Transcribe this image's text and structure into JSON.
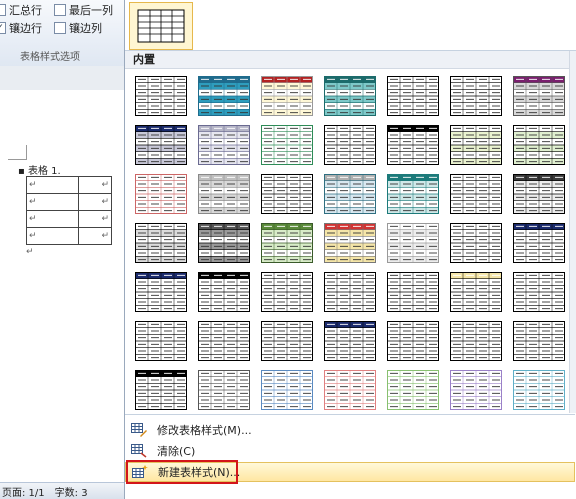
{
  "ribbon": {
    "options": [
      {
        "label": "汇总行",
        "checked": false
      },
      {
        "label": "最后一列",
        "checked": false
      },
      {
        "label": "镶边行",
        "checked": true
      },
      {
        "label": "镶边列",
        "checked": false
      }
    ],
    "group_label": "表格样式选项"
  },
  "document": {
    "table_label": "▪ 表格 1.",
    "cell_mark": "↵",
    "row_count": 4
  },
  "status": {
    "page": "页面: 1/1",
    "words": "字数: 3"
  },
  "gallery": {
    "section_title": "内置",
    "styles": [
      {
        "row": 0,
        "col": 0,
        "header": "#ffffff",
        "band": "#ffffff",
        "border": "#000000"
      },
      {
        "row": 0,
        "col": 1,
        "header": "#1f6b8c",
        "band": "#2e9dbd",
        "border": "#1f6b8c"
      },
      {
        "row": 0,
        "col": 2,
        "header": "#b22222",
        "band": "#fff8d6",
        "border": "#999999"
      },
      {
        "row": 0,
        "col": 3,
        "header": "#1c6b6b",
        "band": "#7ec9c9",
        "border": "#1c6b6b"
      },
      {
        "row": 0,
        "col": 4,
        "header": "#ffffff",
        "band": "#ffffff",
        "border": "#000000"
      },
      {
        "row": 0,
        "col": 5,
        "header": "#ffffff",
        "band": "#ffffff",
        "border": "#000000"
      },
      {
        "row": 0,
        "col": 6,
        "header": "#7a1f6e",
        "band": "#d9d9d9",
        "border": "#555555"
      },
      {
        "row": 1,
        "col": 0,
        "header": "#1a2a6c",
        "band": "#c8c8d8",
        "border": "#000000"
      },
      {
        "row": 1,
        "col": 1,
        "header": "#b6b6c8",
        "band": "#e6e6ef",
        "border": "#6a6a90"
      },
      {
        "row": 1,
        "col": 2,
        "header": "#ffffff",
        "band": "#ffffff",
        "border": "#2e8b57"
      },
      {
        "row": 1,
        "col": 3,
        "header": "#ffffff",
        "band": "#ffffff",
        "border": "#000000"
      },
      {
        "row": 1,
        "col": 4,
        "header": "#000000",
        "band": "#ffffff",
        "border": "#000000"
      },
      {
        "row": 1,
        "col": 5,
        "header": "#ffffff",
        "band": "#eaf3d0",
        "border": "#000000"
      },
      {
        "row": 1,
        "col": 6,
        "header": "#ffffff",
        "band": "#e0f0d0",
        "border": "#000000"
      },
      {
        "row": 2,
        "col": 0,
        "header": "#ffffff",
        "band": "#ffffff",
        "border": "#cc6666"
      },
      {
        "row": 2,
        "col": 1,
        "header": "#c0c0c0",
        "band": "#d8d8d8",
        "border": "#888888"
      },
      {
        "row": 2,
        "col": 2,
        "header": "#ffffff",
        "band": "#ffffff",
        "border": "#000000"
      },
      {
        "row": 2,
        "col": 3,
        "header": "#b0b0b0",
        "band": "#d8e8f0",
        "border": "#2e6e80"
      },
      {
        "row": 2,
        "col": 4,
        "header": "#1c7a7a",
        "band": "#cfe8e8",
        "border": "#1c7a7a"
      },
      {
        "row": 2,
        "col": 5,
        "header": "#ffffff",
        "band": "#ffffff",
        "border": "#000000"
      },
      {
        "row": 2,
        "col": 6,
        "header": "#3a3a3a",
        "band": "#ededed",
        "border": "#000000"
      },
      {
        "row": 3,
        "col": 0,
        "header": "#ffffff",
        "band": "#dcdcdc",
        "border": "#000000"
      },
      {
        "row": 3,
        "col": 1,
        "header": "#555555",
        "band": "#9a9a9a",
        "border": "#000000"
      },
      {
        "row": 3,
        "col": 2,
        "header": "#5a8a3a",
        "band": "#d8ecc8",
        "border": "#3a5a2a"
      },
      {
        "row": 3,
        "col": 3,
        "header": "#d13333",
        "band": "#f5e6a8",
        "border": "#777777"
      },
      {
        "row": 3,
        "col": 4,
        "header": "#ffffff",
        "band": "#ededed",
        "border": "#999999"
      },
      {
        "row": 3,
        "col": 5,
        "header": "#ffffff",
        "band": "#ffffff",
        "border": "#000000"
      },
      {
        "row": 3,
        "col": 6,
        "header": "#1a2a6c",
        "band": "#ffffff",
        "border": "#000000"
      },
      {
        "row": 4,
        "col": 0,
        "header": "#1a2a6c",
        "band": "#ffffff",
        "border": "#000000"
      },
      {
        "row": 4,
        "col": 1,
        "header": "#000000",
        "band": "#ffffff",
        "border": "#000000"
      },
      {
        "row": 4,
        "col": 2,
        "header": "#ffffff",
        "band": "#ffffff",
        "border": "#000000"
      },
      {
        "row": 4,
        "col": 3,
        "header": "#ffffff",
        "band": "#ffffff",
        "border": "#000000"
      },
      {
        "row": 4,
        "col": 4,
        "header": "#ffffff",
        "band": "#ffffff",
        "border": "#000000"
      },
      {
        "row": 4,
        "col": 5,
        "header": "#f5e6a8",
        "band": "#ffffff",
        "border": "#000000"
      },
      {
        "row": 4,
        "col": 6,
        "header": "#ffffff",
        "band": "#ffffff",
        "border": "#000000"
      },
      {
        "row": 5,
        "col": 0,
        "header": "#ffffff",
        "band": "#ffffff",
        "border": "#000000"
      },
      {
        "row": 5,
        "col": 1,
        "header": "#ffffff",
        "band": "#ffffff",
        "border": "#000000"
      },
      {
        "row": 5,
        "col": 2,
        "header": "#ffffff",
        "band": "#ffffff",
        "border": "#000000"
      },
      {
        "row": 5,
        "col": 3,
        "header": "#1a2a6c",
        "band": "#ffffff",
        "border": "#000000"
      },
      {
        "row": 5,
        "col": 4,
        "header": "#ffffff",
        "band": "#ffffff",
        "border": "#000000"
      },
      {
        "row": 5,
        "col": 5,
        "header": "#ffffff",
        "band": "#ffffff",
        "border": "#000000"
      },
      {
        "row": 5,
        "col": 6,
        "header": "#ffffff",
        "band": "#ffffff",
        "border": "#000000"
      },
      {
        "row": 6,
        "col": 0,
        "header": "#000000",
        "band": "#ffffff",
        "border": "#000000"
      },
      {
        "row": 6,
        "col": 1,
        "header": "#ffffff",
        "band": "#ffffff",
        "border": "#555555"
      },
      {
        "row": 6,
        "col": 2,
        "header": "#ffffff",
        "band": "#ffffff",
        "border": "#5a8ac0"
      },
      {
        "row": 6,
        "col": 3,
        "header": "#ffffff",
        "band": "#ffffff",
        "border": "#e08080"
      },
      {
        "row": 6,
        "col": 4,
        "header": "#ffffff",
        "band": "#ffffff",
        "border": "#88c070"
      },
      {
        "row": 6,
        "col": 5,
        "header": "#ffffff",
        "band": "#ffffff",
        "border": "#9a80c8"
      },
      {
        "row": 6,
        "col": 6,
        "header": "#ffffff",
        "band": "#ffffff",
        "border": "#60b0c8"
      }
    ]
  },
  "menu": {
    "modify": "修改表格样式(M)...",
    "clear": "清除(C)",
    "new": "新建表样式(N)..."
  }
}
